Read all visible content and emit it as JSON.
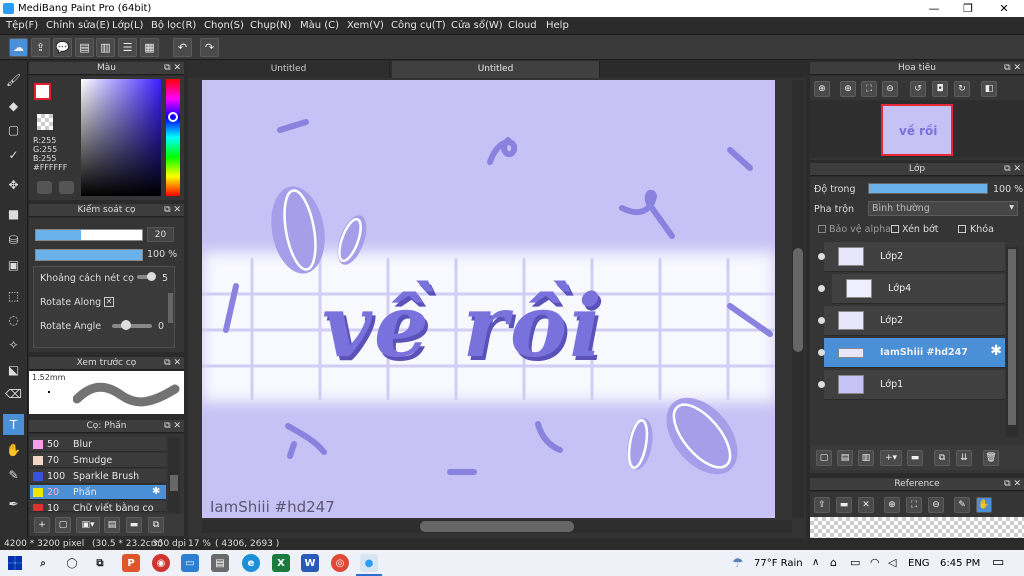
{
  "window": {
    "title": "MediBang Paint Pro (64bit)",
    "min": "—",
    "max": "❐",
    "close": "✕"
  },
  "menu": [
    "Tệp(F)",
    "Chỉnh sửa(E)",
    "Lớp(L)",
    "Bộ lọc(R)",
    "Chọn(S)",
    "Chụp(N)",
    "Màu (C)",
    "Xem(V)",
    "Công cụ(T)",
    "Cửa sổ(W)",
    "Cloud",
    "Help"
  ],
  "tabs": [
    "Untitled",
    "Untitled"
  ],
  "color_panel": {
    "title": "Màu",
    "r": "R:255",
    "g": "G:255",
    "b": "B:255",
    "hex": "#FFFFFF"
  },
  "brush_control": {
    "title": "Kiểm soát cọ",
    "size_value": "20",
    "opacity_value": "100 %",
    "spacing_label": "Khoảng cách nét cọ",
    "spacing_value": "5",
    "rotate_along_label": "Rotate Along",
    "rotate_angle_label": "Rotate Angle",
    "rotate_angle_value": "0"
  },
  "brush_preview": {
    "title": "Xem trước cọ",
    "size": "1.52mm"
  },
  "brush_list": {
    "title": "Cọ: Phấn",
    "items": [
      {
        "num": "50",
        "label": "Blur",
        "color": "#f2a0e8"
      },
      {
        "num": "70",
        "label": "Smudge",
        "color": "#f4d6c6"
      },
      {
        "num": "100",
        "label": "Sparkle Brush",
        "color": "#3552e0"
      },
      {
        "num": "20",
        "label": "Phấn",
        "color": "#e8e800"
      },
      {
        "num": "10",
        "label": "Chữ viết bằng cọ",
        "color": "#e03030"
      }
    ]
  },
  "navigator": {
    "title": "Hoa tiêu"
  },
  "layer_panel": {
    "title": "Lớp",
    "opacity_label": "Độ trong",
    "opacity_value": "100 %",
    "opacity_fraction": 1.0,
    "blend_label": "Pha trộn",
    "blend_value": "Bình thường",
    "protect_alpha": "Bảo vệ alpha",
    "clipping": "Xén bớt",
    "lock": "Khóa",
    "layers": [
      {
        "name": "Lớp2"
      },
      {
        "name": "Lớp4"
      },
      {
        "name": "Lớp2"
      },
      {
        "name": "IamShiii #hd247"
      },
      {
        "name": "Lớp1"
      }
    ]
  },
  "reference": {
    "title": "Reference"
  },
  "canvas": {
    "watermark": "IamShiii #hd247",
    "art_text": "về rồi",
    "bg": "#c7c2f5",
    "accent": "#7a72dc"
  },
  "status": {
    "size": "4200 * 3200 pixel",
    "cm": "(30.5 * 23.2cm)",
    "dpi": "350 dpi",
    "zoom": "17 %",
    "coords": "( 4306, 2693 )"
  },
  "taskbar": {
    "weather": "77°F Rain",
    "lang": "ENG",
    "time": "6:45 PM"
  }
}
